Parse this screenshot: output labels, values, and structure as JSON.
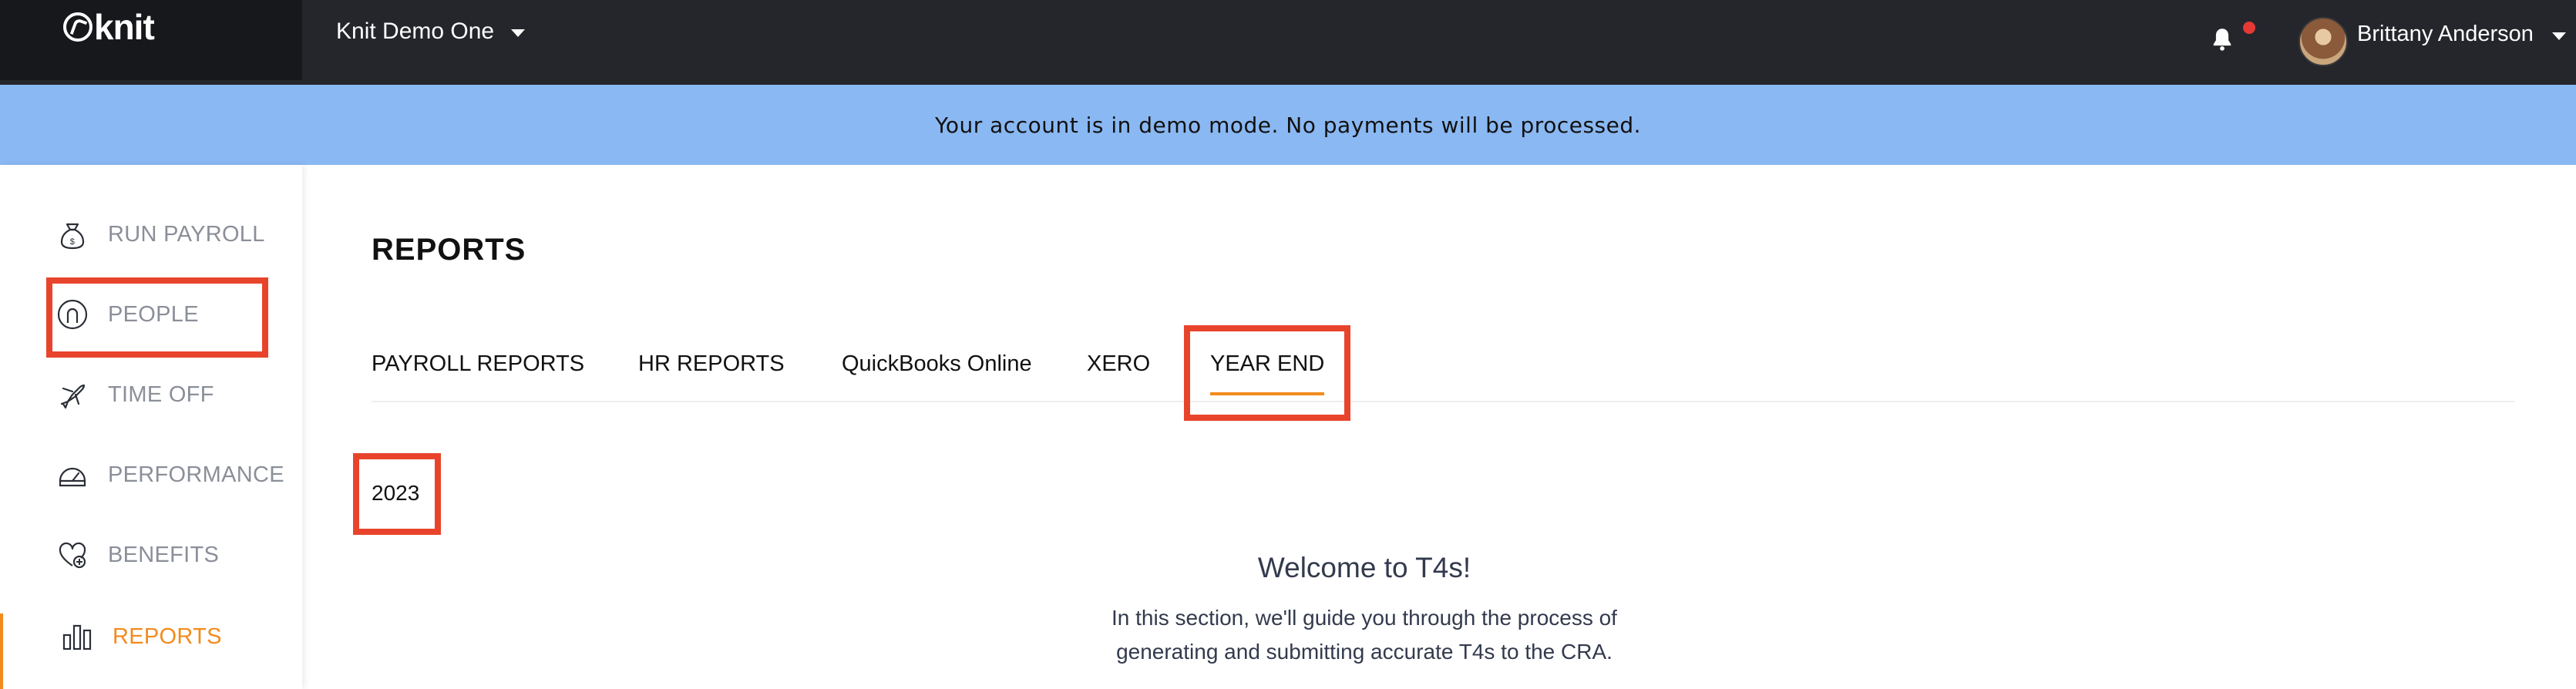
{
  "app": {
    "logo_text": "knit"
  },
  "header": {
    "company_name": "Knit Demo One",
    "user_name": "Brittany Anderson"
  },
  "banner": {
    "text": "Your account is in demo mode. No payments will be processed."
  },
  "sidebar": {
    "items": [
      {
        "label": "RUN PAYROLL",
        "icon": "money-bag-icon",
        "active": false
      },
      {
        "label": "PEOPLE",
        "icon": "person-icon",
        "active": false
      },
      {
        "label": "TIME OFF",
        "icon": "airplane-icon",
        "active": false
      },
      {
        "label": "PERFORMANCE",
        "icon": "gauge-icon",
        "active": false
      },
      {
        "label": "BENEFITS",
        "icon": "heart-plus-icon",
        "active": false
      },
      {
        "label": "REPORTS",
        "icon": "bar-chart-icon",
        "active": true
      }
    ]
  },
  "main": {
    "title": "REPORTS",
    "tabs": [
      {
        "label": "PAYROLL REPORTS",
        "active": false
      },
      {
        "label": "HR REPORTS",
        "active": false
      },
      {
        "label": "QuickBooks Online",
        "active": false
      },
      {
        "label": "XERO",
        "active": false
      },
      {
        "label": "YEAR END",
        "active": true
      }
    ],
    "year": "2023",
    "welcome_title": "Welcome to T4s!",
    "intro_line1": "In this section, we'll guide you through the process of",
    "intro_line2": "generating and submitting accurate T4s to the CRA."
  },
  "colors": {
    "accent": "#f28b1d",
    "highlight": "#e8442c",
    "banner": "#8ab8f2",
    "topbar": "#25262b"
  }
}
